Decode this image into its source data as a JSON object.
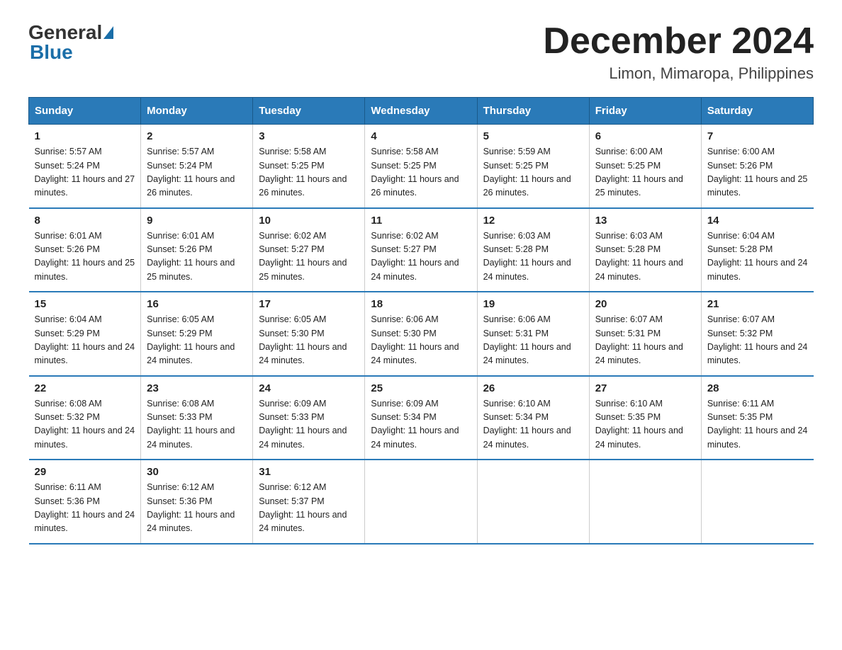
{
  "logo": {
    "general": "General",
    "blue": "Blue"
  },
  "title": "December 2024",
  "location": "Limon, Mimaropa, Philippines",
  "days_of_week": [
    "Sunday",
    "Monday",
    "Tuesday",
    "Wednesday",
    "Thursday",
    "Friday",
    "Saturday"
  ],
  "weeks": [
    [
      {
        "day": "1",
        "sunrise": "5:57 AM",
        "sunset": "5:24 PM",
        "daylight": "11 hours and 27 minutes."
      },
      {
        "day": "2",
        "sunrise": "5:57 AM",
        "sunset": "5:24 PM",
        "daylight": "11 hours and 26 minutes."
      },
      {
        "day": "3",
        "sunrise": "5:58 AM",
        "sunset": "5:25 PM",
        "daylight": "11 hours and 26 minutes."
      },
      {
        "day": "4",
        "sunrise": "5:58 AM",
        "sunset": "5:25 PM",
        "daylight": "11 hours and 26 minutes."
      },
      {
        "day": "5",
        "sunrise": "5:59 AM",
        "sunset": "5:25 PM",
        "daylight": "11 hours and 26 minutes."
      },
      {
        "day": "6",
        "sunrise": "6:00 AM",
        "sunset": "5:25 PM",
        "daylight": "11 hours and 25 minutes."
      },
      {
        "day": "7",
        "sunrise": "6:00 AM",
        "sunset": "5:26 PM",
        "daylight": "11 hours and 25 minutes."
      }
    ],
    [
      {
        "day": "8",
        "sunrise": "6:01 AM",
        "sunset": "5:26 PM",
        "daylight": "11 hours and 25 minutes."
      },
      {
        "day": "9",
        "sunrise": "6:01 AM",
        "sunset": "5:26 PM",
        "daylight": "11 hours and 25 minutes."
      },
      {
        "day": "10",
        "sunrise": "6:02 AM",
        "sunset": "5:27 PM",
        "daylight": "11 hours and 25 minutes."
      },
      {
        "day": "11",
        "sunrise": "6:02 AM",
        "sunset": "5:27 PM",
        "daylight": "11 hours and 24 minutes."
      },
      {
        "day": "12",
        "sunrise": "6:03 AM",
        "sunset": "5:28 PM",
        "daylight": "11 hours and 24 minutes."
      },
      {
        "day": "13",
        "sunrise": "6:03 AM",
        "sunset": "5:28 PM",
        "daylight": "11 hours and 24 minutes."
      },
      {
        "day": "14",
        "sunrise": "6:04 AM",
        "sunset": "5:28 PM",
        "daylight": "11 hours and 24 minutes."
      }
    ],
    [
      {
        "day": "15",
        "sunrise": "6:04 AM",
        "sunset": "5:29 PM",
        "daylight": "11 hours and 24 minutes."
      },
      {
        "day": "16",
        "sunrise": "6:05 AM",
        "sunset": "5:29 PM",
        "daylight": "11 hours and 24 minutes."
      },
      {
        "day": "17",
        "sunrise": "6:05 AM",
        "sunset": "5:30 PM",
        "daylight": "11 hours and 24 minutes."
      },
      {
        "day": "18",
        "sunrise": "6:06 AM",
        "sunset": "5:30 PM",
        "daylight": "11 hours and 24 minutes."
      },
      {
        "day": "19",
        "sunrise": "6:06 AM",
        "sunset": "5:31 PM",
        "daylight": "11 hours and 24 minutes."
      },
      {
        "day": "20",
        "sunrise": "6:07 AM",
        "sunset": "5:31 PM",
        "daylight": "11 hours and 24 minutes."
      },
      {
        "day": "21",
        "sunrise": "6:07 AM",
        "sunset": "5:32 PM",
        "daylight": "11 hours and 24 minutes."
      }
    ],
    [
      {
        "day": "22",
        "sunrise": "6:08 AM",
        "sunset": "5:32 PM",
        "daylight": "11 hours and 24 minutes."
      },
      {
        "day": "23",
        "sunrise": "6:08 AM",
        "sunset": "5:33 PM",
        "daylight": "11 hours and 24 minutes."
      },
      {
        "day": "24",
        "sunrise": "6:09 AM",
        "sunset": "5:33 PM",
        "daylight": "11 hours and 24 minutes."
      },
      {
        "day": "25",
        "sunrise": "6:09 AM",
        "sunset": "5:34 PM",
        "daylight": "11 hours and 24 minutes."
      },
      {
        "day": "26",
        "sunrise": "6:10 AM",
        "sunset": "5:34 PM",
        "daylight": "11 hours and 24 minutes."
      },
      {
        "day": "27",
        "sunrise": "6:10 AM",
        "sunset": "5:35 PM",
        "daylight": "11 hours and 24 minutes."
      },
      {
        "day": "28",
        "sunrise": "6:11 AM",
        "sunset": "5:35 PM",
        "daylight": "11 hours and 24 minutes."
      }
    ],
    [
      {
        "day": "29",
        "sunrise": "6:11 AM",
        "sunset": "5:36 PM",
        "daylight": "11 hours and 24 minutes."
      },
      {
        "day": "30",
        "sunrise": "6:12 AM",
        "sunset": "5:36 PM",
        "daylight": "11 hours and 24 minutes."
      },
      {
        "day": "31",
        "sunrise": "6:12 AM",
        "sunset": "5:37 PM",
        "daylight": "11 hours and 24 minutes."
      },
      null,
      null,
      null,
      null
    ]
  ]
}
